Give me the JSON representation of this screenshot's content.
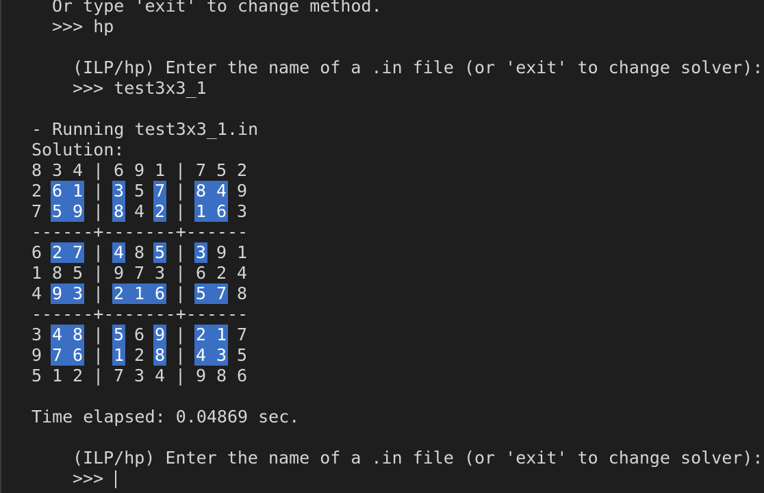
{
  "terminal": {
    "lines": {
      "l0": "Or type 'exit' to change method.",
      "l1": ">>> hp",
      "l2": "(ILP/hp) Enter the name of a .in file (or 'exit' to change solver):",
      "l3": ">>> test3x3_1",
      "l4": "- Running test3x3_1.in",
      "l5": "Solution:",
      "time": "Time elapsed: 0.04869 sec.",
      "l6": "(ILP/hp) Enter the name of a .in file (or 'exit' to change solver):",
      "prompt": ">>> "
    },
    "separator_line": "------+-------+------",
    "grid": [
      [
        8,
        3,
        4,
        6,
        9,
        1,
        7,
        5,
        2
      ],
      [
        2,
        6,
        1,
        3,
        5,
        7,
        8,
        4,
        9
      ],
      [
        7,
        5,
        9,
        8,
        4,
        2,
        1,
        6,
        3
      ],
      [
        6,
        2,
        7,
        4,
        8,
        5,
        3,
        9,
        1
      ],
      [
        1,
        8,
        5,
        9,
        7,
        3,
        6,
        2,
        4
      ],
      [
        4,
        9,
        3,
        2,
        1,
        6,
        5,
        7,
        8
      ],
      [
        3,
        4,
        8,
        5,
        6,
        9,
        2,
        1,
        7
      ],
      [
        9,
        7,
        6,
        1,
        2,
        8,
        4,
        3,
        5
      ],
      [
        5,
        1,
        2,
        7,
        3,
        4,
        9,
        8,
        6
      ]
    ],
    "highlighted": [
      [
        false,
        false,
        false,
        false,
        false,
        false,
        false,
        false,
        false
      ],
      [
        false,
        true,
        true,
        true,
        false,
        true,
        true,
        true,
        false
      ],
      [
        false,
        true,
        true,
        true,
        false,
        true,
        true,
        true,
        false
      ],
      [
        false,
        true,
        true,
        true,
        false,
        true,
        true,
        false,
        false
      ],
      [
        false,
        false,
        false,
        false,
        false,
        false,
        false,
        false,
        false
      ],
      [
        false,
        true,
        true,
        true,
        true,
        true,
        true,
        true,
        false
      ],
      [
        false,
        true,
        true,
        true,
        false,
        true,
        true,
        true,
        false
      ],
      [
        false,
        true,
        true,
        true,
        false,
        true,
        true,
        true,
        false
      ],
      [
        false,
        false,
        false,
        false,
        false,
        false,
        false,
        false,
        false
      ]
    ],
    "colors": {
      "background": "#1e1e1e",
      "text": "#d4d4d4",
      "highlight": "#3a6fc4"
    }
  }
}
